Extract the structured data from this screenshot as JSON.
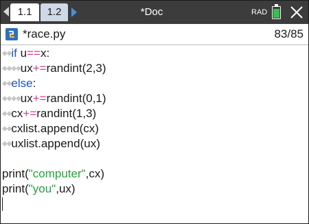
{
  "window": {
    "tabs": [
      {
        "label": "1.1"
      },
      {
        "label": "1.2"
      }
    ],
    "doc_title": "*Doc",
    "angle_mode": "RAD",
    "battery_color": "#33c24a"
  },
  "editor": {
    "file_name": "*race.py",
    "line_position": "83/85",
    "lines": [
      {
        "indent": "◆◆",
        "parts": [
          {
            "t": "if",
            "c": "kw"
          },
          {
            "t": " u",
            "c": "id"
          },
          {
            "t": "==",
            "c": "op"
          },
          {
            "t": "x:",
            "c": "id"
          }
        ]
      },
      {
        "indent": "◆◆◆◆",
        "parts": [
          {
            "t": "ux",
            "c": "id"
          },
          {
            "t": "+=",
            "c": "op"
          },
          {
            "t": "randint(2,3)",
            "c": "fn"
          }
        ]
      },
      {
        "indent": "◆◆",
        "parts": [
          {
            "t": "else",
            "c": "kw"
          },
          {
            "t": ":",
            "c": "id"
          }
        ]
      },
      {
        "indent": "◆◆◆◆",
        "parts": [
          {
            "t": "ux",
            "c": "id"
          },
          {
            "t": "+=",
            "c": "op"
          },
          {
            "t": "randint(0,1)",
            "c": "fn"
          }
        ]
      },
      {
        "indent": "◆◆",
        "parts": [
          {
            "t": "cx",
            "c": "id"
          },
          {
            "t": "+=",
            "c": "op"
          },
          {
            "t": "randint(1,3)",
            "c": "fn"
          }
        ]
      },
      {
        "indent": "◆◆",
        "parts": [
          {
            "t": "cxlist.append(cx)",
            "c": "fn"
          }
        ]
      },
      {
        "indent": "◆◆",
        "parts": [
          {
            "t": "uxlist.append(ux)",
            "c": "fn"
          }
        ]
      },
      {
        "indent": "",
        "parts": []
      },
      {
        "indent": "",
        "parts": [
          {
            "t": "print(",
            "c": "fn"
          },
          {
            "t": "\"computer\"",
            "c": "str"
          },
          {
            "t": ",cx)",
            "c": "fn"
          }
        ]
      },
      {
        "indent": "",
        "parts": [
          {
            "t": "print(",
            "c": "fn"
          },
          {
            "t": "\"you\"",
            "c": "str"
          },
          {
            "t": ",ux)",
            "c": "fn"
          }
        ]
      },
      {
        "indent": "",
        "parts": []
      }
    ]
  },
  "colors": {
    "keyword": "#1a55c7",
    "operator": "#d43a8c",
    "string": "#22a43a",
    "titlebar": "#3c3c3c"
  }
}
